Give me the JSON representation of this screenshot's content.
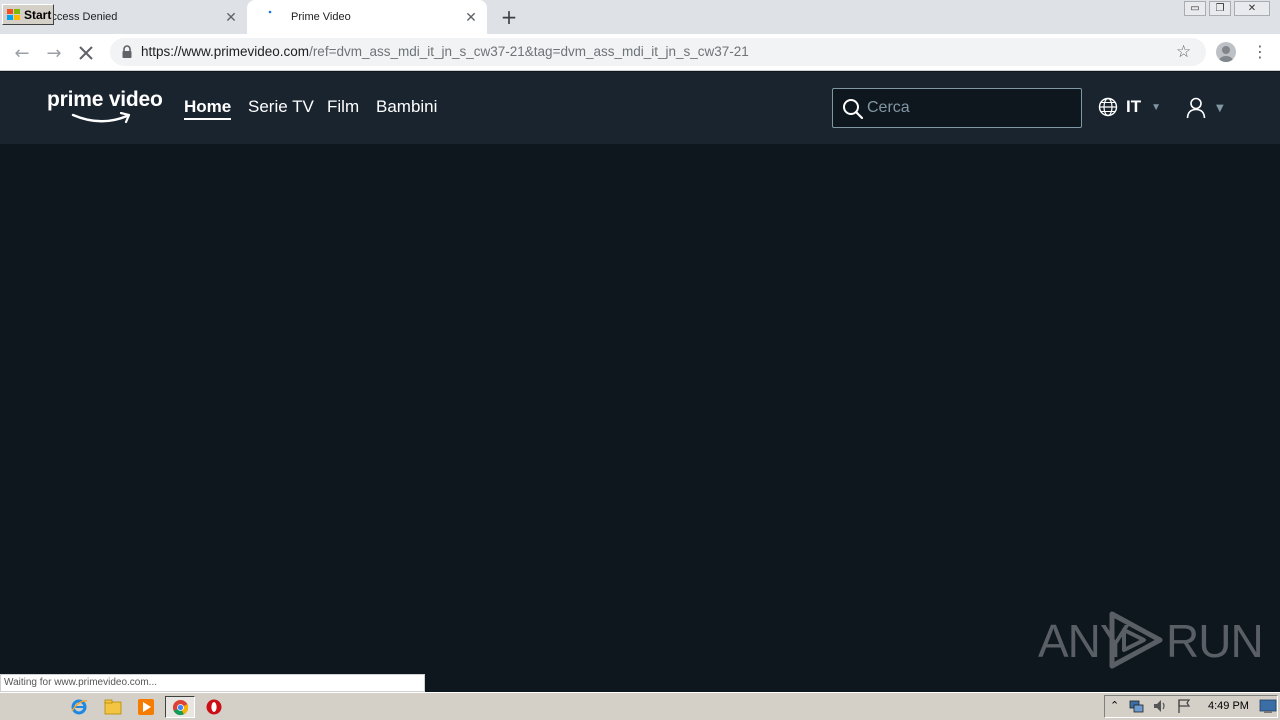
{
  "browser": {
    "tabs": [
      {
        "title": "Access Denied"
      },
      {
        "title": "Prime Video"
      }
    ],
    "url_host": "https://www.primevideo.com",
    "url_rest": "/ref=dvm_ass_mdi_it_jn_s_cw37-21&tag=dvm_ass_mdi_it_jn_s_cw37-21",
    "status_text": "Waiting for www.primevideo.com..."
  },
  "site": {
    "logo_text": "prime video",
    "nav": {
      "home": "Home",
      "serie": "Serie TV",
      "film": "Film",
      "bambini": "Bambini"
    },
    "search_placeholder": "Cerca",
    "language": "IT"
  },
  "watermark": {
    "left": "ANY",
    "right": "RUN"
  },
  "taskbar": {
    "start_label": "Start",
    "clock": "4:49 PM"
  },
  "colors": {
    "header_bg": "#1a242f",
    "page_bg": "#0f171e",
    "search_border": "#8197a4"
  }
}
